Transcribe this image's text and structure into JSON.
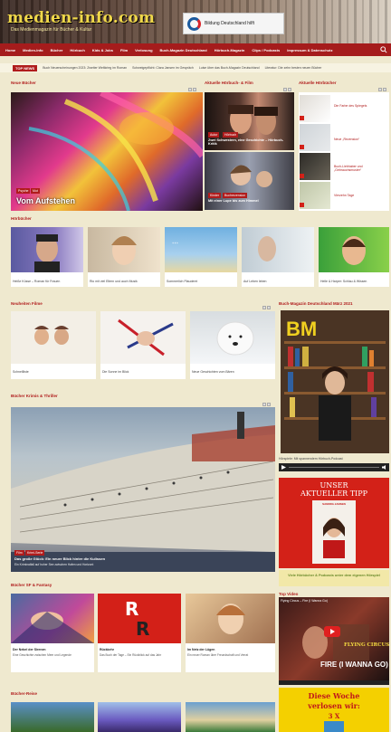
{
  "header": {
    "logo": "medien-info.com",
    "tagline": "Das Medienmagazin für Bücher & Kultur",
    "banner_text": "Bildung Deutschland hilft"
  },
  "nav": {
    "items": [
      "Home",
      "Medien-Info",
      "Bücher",
      "Hörbuch",
      "Kids & Jobs",
      "Film",
      "Verlosung",
      "Buch-Magazin Deutschland",
      "Hörbuch-Magazin",
      "Clips / Podcasts",
      "Impressum & Datenschutz"
    ]
  },
  "ticker": {
    "badge": "TOP NEWS",
    "items": [
      "Buch Neuerscheinungen 2023: Zweiter Weltkrieg im Roman",
      "Schweigepflicht: Clara Jansen im Gespräch",
      "Luise über das Buch-Magazin Deutschland",
      "Literatur: Die zehn besten neuen Bücher"
    ]
  },
  "sections": {
    "neue_buecher": "Neue Bücher",
    "aktuelle_rf": "Aktuelle Hörbuch- & Film",
    "aktuelle_hoer": "Aktuelle Hörbücher",
    "hoerbuecher": "Hörbücher",
    "neuheiten": "Neuheiten Filme",
    "magazin": "Buch-Magazin Deutschland März 2021",
    "krimis": "Bücher Krimis & Thriller",
    "fantasy": "Bücher SF & Fantasy",
    "top_video": "Top Video",
    "reise": "Bücher-Reise"
  },
  "hero": {
    "tags": [
      "Psyche",
      "Mut"
    ],
    "title": "Vom Aufstehen"
  },
  "rf_cards": [
    {
      "tags": [
        "Autor",
        "Hörbuch"
      ],
      "title": "Zwei Schwestern, eine Geschichte – Hörbuch-Kritik"
    },
    {
      "tags": [
        "Kinder",
        "Buchrezension"
      ],
      "title": "Mit einer Lupe bis zum Himmel"
    }
  ],
  "side_items": [
    {
      "title": "Die Farbe des Spiegels"
    },
    {
      "title": "Neue „Rezension“"
    },
    {
      "title": "Buch-Liebhaber und „Gebrauchsmuster“"
    },
    {
      "title": "Vierzehn Tage"
    }
  ],
  "hoerbuecher": [
    {
      "title": "Heiße Küsse – Roman für Frauen"
    },
    {
      "title": "Rio mit viel Eltern und auch Musik"
    },
    {
      "title": "Sommerlich Plauderei"
    },
    {
      "title": "Auf Leben leben"
    },
    {
      "title": "Helle & Harper: Schlau & Wissen"
    }
  ],
  "filme": [
    {
      "title": "Schnellliste"
    },
    {
      "title": "Die Sonne im Blick"
    },
    {
      "title": "Neue Geschichten vom Bären"
    }
  ],
  "krimi": {
    "tags": [
      "Film",
      "Krimi-Serie"
    ],
    "caption": "Das große Glück: Ein neuer Blick hinter die Kulissen",
    "subcaption": "Ein Kriminalfall auf hoher See zwischen Hafen und Horizont"
  },
  "fantasy": [
    {
      "title": "Der Nebel der Sirenen",
      "sub": "Eine Geschichte zwischen Meer und Legende"
    },
    {
      "title": "Rückkehr",
      "sub": "Das Buch der Tage – Ein Rückblick auf das Jahr"
    },
    {
      "title": "Im Netz der Lügen",
      "sub": "Ein neuer Roman über Freundschaft und Verrat"
    }
  ],
  "ad_tipp": {
    "line1": "UNSER",
    "line2": "AKTUELLER TIPP",
    "author": "SANDRA JANSEN",
    "footer": "Viele Hörbücher & Podcasts unter dem eigenen Hörspiel"
  },
  "video": {
    "title": "Flying Circus – Fire (I Wanna Go)",
    "overlay": "FLYING CIRCUS",
    "song": "FIRE (I WANNA GO)"
  },
  "verlosung": {
    "line1": "Diese Woche",
    "line2": "verlosen wir:",
    "count": "3 X"
  },
  "podcast_caption": "Hörspiele: Mit spannendem Hörbuch-Podcast",
  "colors": {
    "accent": "#b01c1c",
    "nav": "#a51c1c",
    "background": "#efe9cf",
    "logo": "#f0d84a"
  }
}
